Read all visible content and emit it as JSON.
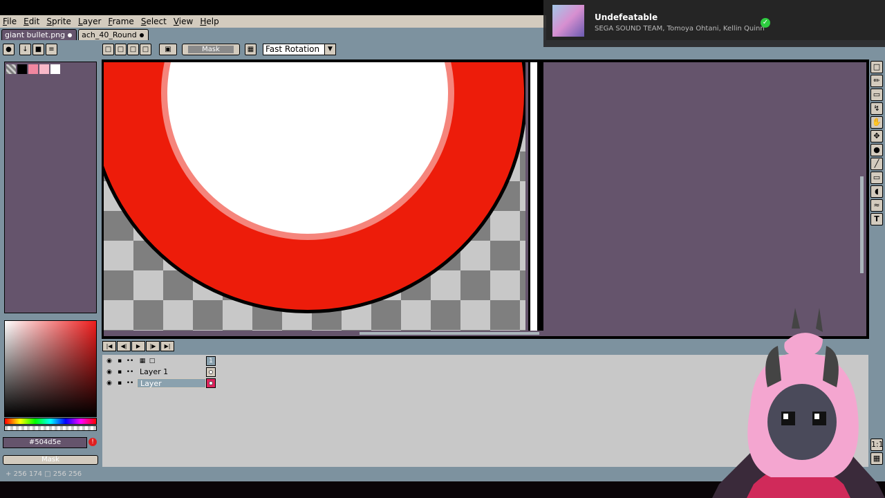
{
  "menu": [
    "File",
    "Edit",
    "Sprite",
    "Layer",
    "Frame",
    "Select",
    "View",
    "Help"
  ],
  "tabs": [
    {
      "label": "giant bullet.png",
      "active": true
    },
    {
      "label": "ach_40_Round",
      "active": false
    }
  ],
  "toolbar": {
    "mask_label": "Mask",
    "rotation_mode": "Fast Rotation"
  },
  "palette": [
    "#7f7f7f",
    "#000000",
    "#f087a0",
    "#f8b8c8",
    "#ffffff"
  ],
  "color_picker": {
    "hex": "#504d5e",
    "mask_label": "Mask"
  },
  "layers": [
    {
      "name": "Layer 1"
    },
    {
      "name": "Layer",
      "selected": true
    }
  ],
  "frame_header": "1",
  "status": {
    "coords": "256 174",
    "size": "256 256"
  },
  "now_playing": {
    "title": "Undefeatable",
    "artist": "SEGA SOUND TEAM, Tomoya Ohtani, Kellin Quinn"
  },
  "colors": {
    "panel": "#7d929f",
    "bg": "#65546c",
    "button": "#d3cbbe",
    "red": "#ed1c0a",
    "pink": "#f5857c"
  }
}
